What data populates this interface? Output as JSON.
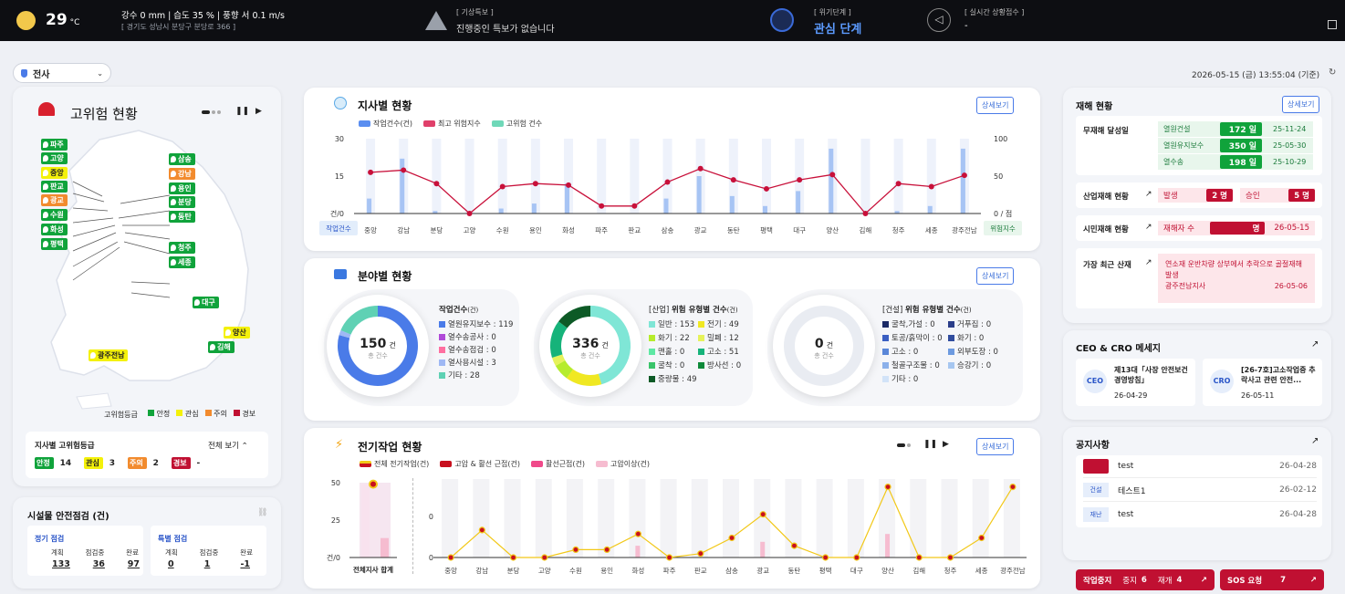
{
  "header": {
    "temp": "29",
    "temp_unit": "°C",
    "weather_line": "강수 0 mm | 습도 35 % | 풍향 서 0.1 m/s",
    "location": "[ 경기도 성남시 분당구 분당로 366 ]",
    "alert_label": "[ 기상특보 ]",
    "alert_text": "진행중인 특보가 없습니다",
    "crisis_label": "[ 위기단계 ]",
    "crisis_value": "관심 단계",
    "live_label": "[ 실시간 상황접수 ]",
    "live_value": "-"
  },
  "selector": {
    "value": "전사"
  },
  "datetime": "2026-05-15 (금) 13:55:04 (기준)",
  "risk": {
    "title": "고위험 현황",
    "legend_label": "고위험등급",
    "legend": [
      {
        "name": "안정",
        "color": "#10a33b"
      },
      {
        "name": "관심",
        "color": "#f4f10a"
      },
      {
        "name": "주의",
        "color": "#f28b2e"
      },
      {
        "name": "경보",
        "color": "#c01032"
      }
    ],
    "markers": [
      {
        "name": "파주",
        "c": "g"
      },
      {
        "name": "고양",
        "c": "g"
      },
      {
        "name": "중앙",
        "c": "y"
      },
      {
        "name": "판교",
        "c": "g"
      },
      {
        "name": "광교",
        "c": "o"
      },
      {
        "name": "수원",
        "c": "g"
      },
      {
        "name": "화성",
        "c": "g"
      },
      {
        "name": "평택",
        "c": "g"
      },
      {
        "name": "삼송",
        "c": "g"
      },
      {
        "name": "강남",
        "c": "o"
      },
      {
        "name": "용인",
        "c": "g"
      },
      {
        "name": "분당",
        "c": "g"
      },
      {
        "name": "동탄",
        "c": "g"
      },
      {
        "name": "청주",
        "c": "g"
      },
      {
        "name": "세종",
        "c": "g"
      },
      {
        "name": "대구",
        "c": "g"
      },
      {
        "name": "양산",
        "c": "y"
      },
      {
        "name": "김해",
        "c": "g"
      },
      {
        "name": "광주전남",
        "c": "y"
      }
    ],
    "grade_title": "지사별 고위험등급",
    "grade_toggle": "전체 보기",
    "grades": [
      {
        "name": "안정",
        "count": "14"
      },
      {
        "name": "관심",
        "count": "3"
      },
      {
        "name": "주의",
        "count": "2"
      },
      {
        "name": "경보",
        "count": "-"
      }
    ]
  },
  "facility": {
    "title": "시설물 안전점검 (건)",
    "regular": {
      "title": "정기 점검",
      "labels": [
        "계획",
        "점검중",
        "완료"
      ],
      "values": [
        "133",
        "36",
        "97"
      ]
    },
    "special": {
      "title": "특별 점검",
      "labels": [
        "계획",
        "점검중",
        "완료"
      ],
      "values": [
        "0",
        "1",
        "-1"
      ]
    }
  },
  "branch": {
    "title": "지사별 현황",
    "detail": "상세보기",
    "legend": [
      "작업건수(건)",
      "최고 위험지수",
      "고위험 건수"
    ],
    "y_left": [
      "30",
      "15",
      "건/0"
    ],
    "y_right": [
      "100",
      "50",
      "0 / 점"
    ],
    "left_tag": "작업건수",
    "right_tag": "위험지수"
  },
  "field": {
    "title": "분야별 현황",
    "detail": "상세보기",
    "d1": {
      "value": "150",
      "unit": "건",
      "sub": "총 건수",
      "title": "작업건수",
      "title_suffix": "(건)",
      "items": [
        {
          "t": "열원유지보수 : 119",
          "c": "#4a7be8"
        },
        {
          "t": "열수송공사 : 0",
          "c": "#b04ad8"
        },
        {
          "t": "열수송점검 : 0",
          "c": "#ff6fa0"
        },
        {
          "t": "열사용시설 : 3",
          "c": "#9fb8f4"
        },
        {
          "t": "기타 : 28",
          "c": "#5fd1b4"
        }
      ]
    },
    "d2": {
      "value": "336",
      "unit": "건",
      "sub": "총 건수",
      "title_pre": "[산업]",
      "title": "위험 유형별 건수",
      "title_suffix": "(건)",
      "items": [
        {
          "t": "일반 : 153",
          "c": "#7fe6d6"
        },
        {
          "t": "전기 : 49",
          "c": "#f0e822"
        },
        {
          "t": "화기 : 22",
          "c": "#b6ec2c"
        },
        {
          "t": "밀폐 : 12",
          "c": "#e6f25a"
        },
        {
          "t": "맨홀 : 0",
          "c": "#5ee8a4"
        },
        {
          "t": "고소 : 51",
          "c": "#16b37a"
        },
        {
          "t": "굴착 : 0",
          "c": "#3ac46a"
        },
        {
          "t": "방사선 : 0",
          "c": "#0f8a3a"
        },
        {
          "t": "중량물 : 49",
          "c": "#0d5a26"
        }
      ]
    },
    "d3": {
      "value": "0",
      "unit": "건",
      "sub": "총 건수",
      "title_pre": "[건설]",
      "title": "위험 유형별 건수",
      "title_suffix": "(건)",
      "items": [
        {
          "t": "굴착,가설 : 0",
          "c": "#1b2a66"
        },
        {
          "t": "거푸집 : 0",
          "c": "#2b3e8a"
        },
        {
          "t": "토공/흙막이 : 0",
          "c": "#3b5fc2"
        },
        {
          "t": "화기 : 0",
          "c": "#304c9e"
        },
        {
          "t": "고소 : 0",
          "c": "#5a86d8"
        },
        {
          "t": "외부도장 : 0",
          "c": "#6d9ae0"
        },
        {
          "t": "철골구조물 : 0",
          "c": "#8bb0ea"
        },
        {
          "t": "승강기 : 0",
          "c": "#a6c6f0"
        },
        {
          "t": "기타 : 0",
          "c": "#d2e3f8"
        }
      ]
    }
  },
  "electric": {
    "title": "전기작업 현황",
    "detail": "상세보기",
    "legend": [
      "전체 전기작업(건)",
      "고압 & 활선 근접(건)",
      "활선근접(건)",
      "고압이상(건)"
    ],
    "y_left": [
      "50",
      "25",
      "건/0"
    ],
    "total_label": "전체지사 합계",
    "y_right_top": "0",
    "y_right_bottom": "0"
  },
  "chart_data": [
    {
      "type": "bar",
      "title": "지사별 현황",
      "categories": [
        "중앙",
        "강남",
        "분당",
        "고양",
        "수원",
        "용인",
        "화성",
        "파주",
        "판교",
        "삼송",
        "광교",
        "동탄",
        "평택",
        "대구",
        "양산",
        "김해",
        "청주",
        "세종",
        "광주전남"
      ],
      "series": [
        {
          "name": "작업건수(건)",
          "values": [
            6,
            22,
            1,
            0,
            2,
            4,
            12,
            0,
            0,
            6,
            15,
            7,
            3,
            9,
            26,
            0,
            1,
            3,
            26
          ]
        },
        {
          "name": "최고 위험지수",
          "values": [
            55,
            58,
            40,
            0,
            36,
            40,
            38,
            10,
            10,
            42,
            60,
            45,
            33,
            45,
            52,
            0,
            40,
            36,
            51
          ]
        },
        {
          "name": "고위험 건수",
          "values": [
            0,
            0,
            0,
            0,
            0,
            0,
            0,
            0,
            0,
            0,
            0,
            0,
            0,
            0,
            0,
            0,
            0,
            0,
            0
          ]
        }
      ],
      "ylim": [
        0,
        30
      ],
      "y2lim": [
        0,
        100
      ]
    },
    {
      "type": "bar",
      "title": "전기작업 현황",
      "categories": [
        "중앙",
        "강남",
        "분당",
        "고양",
        "수원",
        "용인",
        "화성",
        "파주",
        "판교",
        "삼송",
        "광교",
        "동탄",
        "평택",
        "대구",
        "양산",
        "김해",
        "청주",
        "세종",
        "광주전남"
      ],
      "series": [
        {
          "name": "전체 전기작업(건)",
          "values": [
            0,
            7,
            0,
            0,
            2,
            2,
            6,
            0,
            1,
            5,
            11,
            3,
            0,
            0,
            18,
            0,
            0,
            5,
            18
          ]
        },
        {
          "name": "고압이상(건)",
          "values": [
            0,
            0,
            0,
            0,
            0,
            0,
            3,
            0,
            0,
            0,
            4,
            0,
            0,
            0,
            6,
            0,
            0,
            0,
            0
          ]
        }
      ],
      "totals": {
        "전체 전기작업(건)": 49,
        "고압 & 활선 근접(건)": 0,
        "활선근접(건)": 0,
        "고압이상(건)": 13
      }
    }
  ],
  "disaster": {
    "title": "재해 현황",
    "detail": "상세보기",
    "zero_label": "무재해 달성일",
    "zero_rows": [
      {
        "name": "열원건설",
        "days": "172 일",
        "date": "25-11-24"
      },
      {
        "name": "열원유지보수",
        "days": "350 일",
        "date": "25-05-30"
      },
      {
        "name": "열수송",
        "days": "198 일",
        "date": "25-10-29"
      }
    ],
    "industrial_label": "산업재해 현황",
    "ind_occur": "발생",
    "ind_occur_val": "2 명",
    "ind_approve": "승인",
    "ind_approve_val": "5 명",
    "citizen_label": "시민재해 현황",
    "cit_name": "재해자 수",
    "cit_val": "명",
    "cit_date": "26-05-15",
    "recent_label": "가장 최근 산재",
    "recent_text": "연소재 운반차량 상부에서 추락으로 골절재해 발생",
    "recent_org": "광주전남지사",
    "recent_date": "26-05-06"
  },
  "ceo": {
    "title": "CEO & CRO 메세지",
    "items": [
      {
        "tag": "CEO",
        "text": "제13대「사장 안전보건 경영방침」",
        "date": "26-04-29"
      },
      {
        "tag": "CRO",
        "text": "[26-7호]고소작업중 추락사고 관련 안전...",
        "date": "26-05-11"
      }
    ]
  },
  "notice": {
    "title": "공지사항",
    "items": [
      {
        "tag": "",
        "text": "test",
        "date": "26-04-28"
      },
      {
        "tag": "건설",
        "text": "테스트1",
        "date": "26-02-12"
      },
      {
        "tag": "재난",
        "text": "test",
        "date": "26-04-28"
      }
    ]
  },
  "footer": {
    "stop_label": "작업중지",
    "stop_k1": "중지",
    "stop_v1": "6",
    "stop_k2": "재개",
    "stop_v2": "4",
    "sos_label": "SOS 요청",
    "sos_val": "7"
  }
}
